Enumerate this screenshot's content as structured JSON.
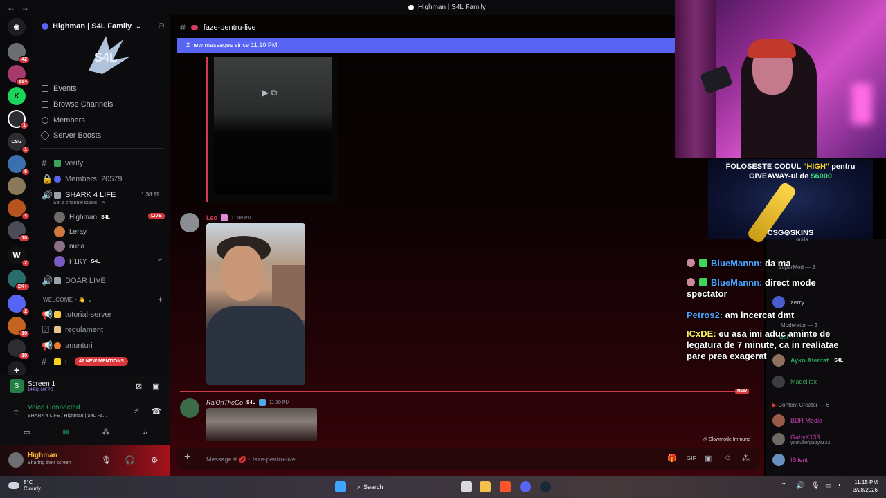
{
  "window": {
    "title": "Highman | S4L Family",
    "nav": "←→"
  },
  "colors": {
    "accent": "#5865f2",
    "danger": "#da373c",
    "online": "#23a55a",
    "brand_red": "#d03b50"
  },
  "rail": {
    "servers": [
      {
        "icon": "discord-icon",
        "badge": ""
      },
      {
        "icon": "server-icon",
        "badge": "42"
      },
      {
        "icon": "server-icon",
        "badge": "554"
      },
      {
        "icon": "server-icon",
        "badge": ""
      },
      {
        "icon": "server-icon",
        "badge": "1"
      },
      {
        "icon": "server-icon",
        "badge": "1"
      },
      {
        "icon": "server-icon",
        "badge": "6"
      },
      {
        "icon": "server-icon",
        "badge": ""
      },
      {
        "icon": "server-icon",
        "badge": "4"
      },
      {
        "icon": "server-icon",
        "badge": "10"
      },
      {
        "icon": "server-icon",
        "badge": "2"
      },
      {
        "icon": "server-icon",
        "badge": "2K+"
      },
      {
        "icon": "server-icon",
        "badge": "2"
      },
      {
        "icon": "server-icon",
        "badge": "10"
      },
      {
        "icon": "server-icon",
        "badge": "10"
      },
      {
        "icon": "add-icon",
        "badge": ""
      }
    ]
  },
  "sidebar": {
    "server_name": "Highman | S4L Family",
    "menu": [
      "Events",
      "Browse Channels",
      "Members",
      "Server Boosts"
    ],
    "channels": {
      "verify": "verify",
      "members": "Members: 20579",
      "voice1": "SHARK 4 LIFE",
      "voice1_time": "1:38:11",
      "voice1_status": "Set a channel status",
      "voice_users": [
        {
          "name": "Highman",
          "tag": "S4L",
          "live": "LIVE"
        },
        {
          "name": "Leray",
          "tag": "",
          "live": ""
        },
        {
          "name": "nuria",
          "tag": "",
          "live": ""
        },
        {
          "name": "P1KY",
          "tag": "S4L",
          "live": ""
        }
      ],
      "voice2": "DOAR LIVE",
      "category": "WELCOME - 👋",
      "text": [
        "tutorial-server",
        "regulament",
        "anunturi",
        "r"
      ]
    },
    "mentions": "42 NEW MENTIONS"
  },
  "panel": {
    "screen_title": "Screen 1",
    "screen_sub": "1440p 60FPS",
    "voice_connected": "Voice Connected",
    "voice_where": "SHARK 4 LIFE / Highman | S4L Fa...",
    "user_name": "Highman",
    "user_status": "Sharing their screen"
  },
  "chat": {
    "channel": "faze-pentru-live",
    "new_messages": "2 new messages since 11:10 PM",
    "msg1": {
      "author": "Leo",
      "time": "11:08 PM"
    },
    "msg2": {
      "author": "RaiOnTheGo",
      "tag": "S4L",
      "time": "11:10 PM"
    },
    "new_label": "NEW",
    "slowmode": "Slowmode Immune",
    "placeholder": "Message # 💋・faze-pentru-live"
  },
  "stream": {
    "promo_line1_a": "FOLOSESTE CODUL ",
    "promo_line1_b": "\"HIGH\"",
    "promo_line1_c": " pentru",
    "promo_line2_a": "GIVEAWAY-ul de ",
    "promo_line2_b": "$6000",
    "promo_brand": "CSG⊙SKINS",
    "chat": [
      {
        "user": "BlueMannn:",
        "text": "da ma"
      },
      {
        "user": "BlueMannn:",
        "text": "direct mode spectator"
      },
      {
        "user": "Petros2:",
        "text": "am incercat dmt"
      },
      {
        "user": "ICxDE:",
        "text": "eu asa imi aduc aminte de legatura de 7 minute, ca in realiatae pare prea exagerat"
      }
    ]
  },
  "members": {
    "groups": {
      "supermod": "SuperMod — 2",
      "moderator": "Moderator — 3",
      "creator": "Content Creator — 6"
    },
    "users": {
      "nuria": "nuria",
      "zerry": "zerry",
      "adi": "adi",
      "ayko": "Ayko.Atentat",
      "ayko_tag": "S4L",
      "madeillex": "Madeillex",
      "bdr": "BDR Media",
      "gaby": "GabyX133",
      "gaby_sub": "youtube/gabyx133",
      "isilent": "ISilent"
    }
  },
  "taskbar": {
    "temp": "8°C",
    "weather": "Cloudy",
    "search": "Search",
    "time": "11:15 PM",
    "date": "3/28/2026"
  }
}
